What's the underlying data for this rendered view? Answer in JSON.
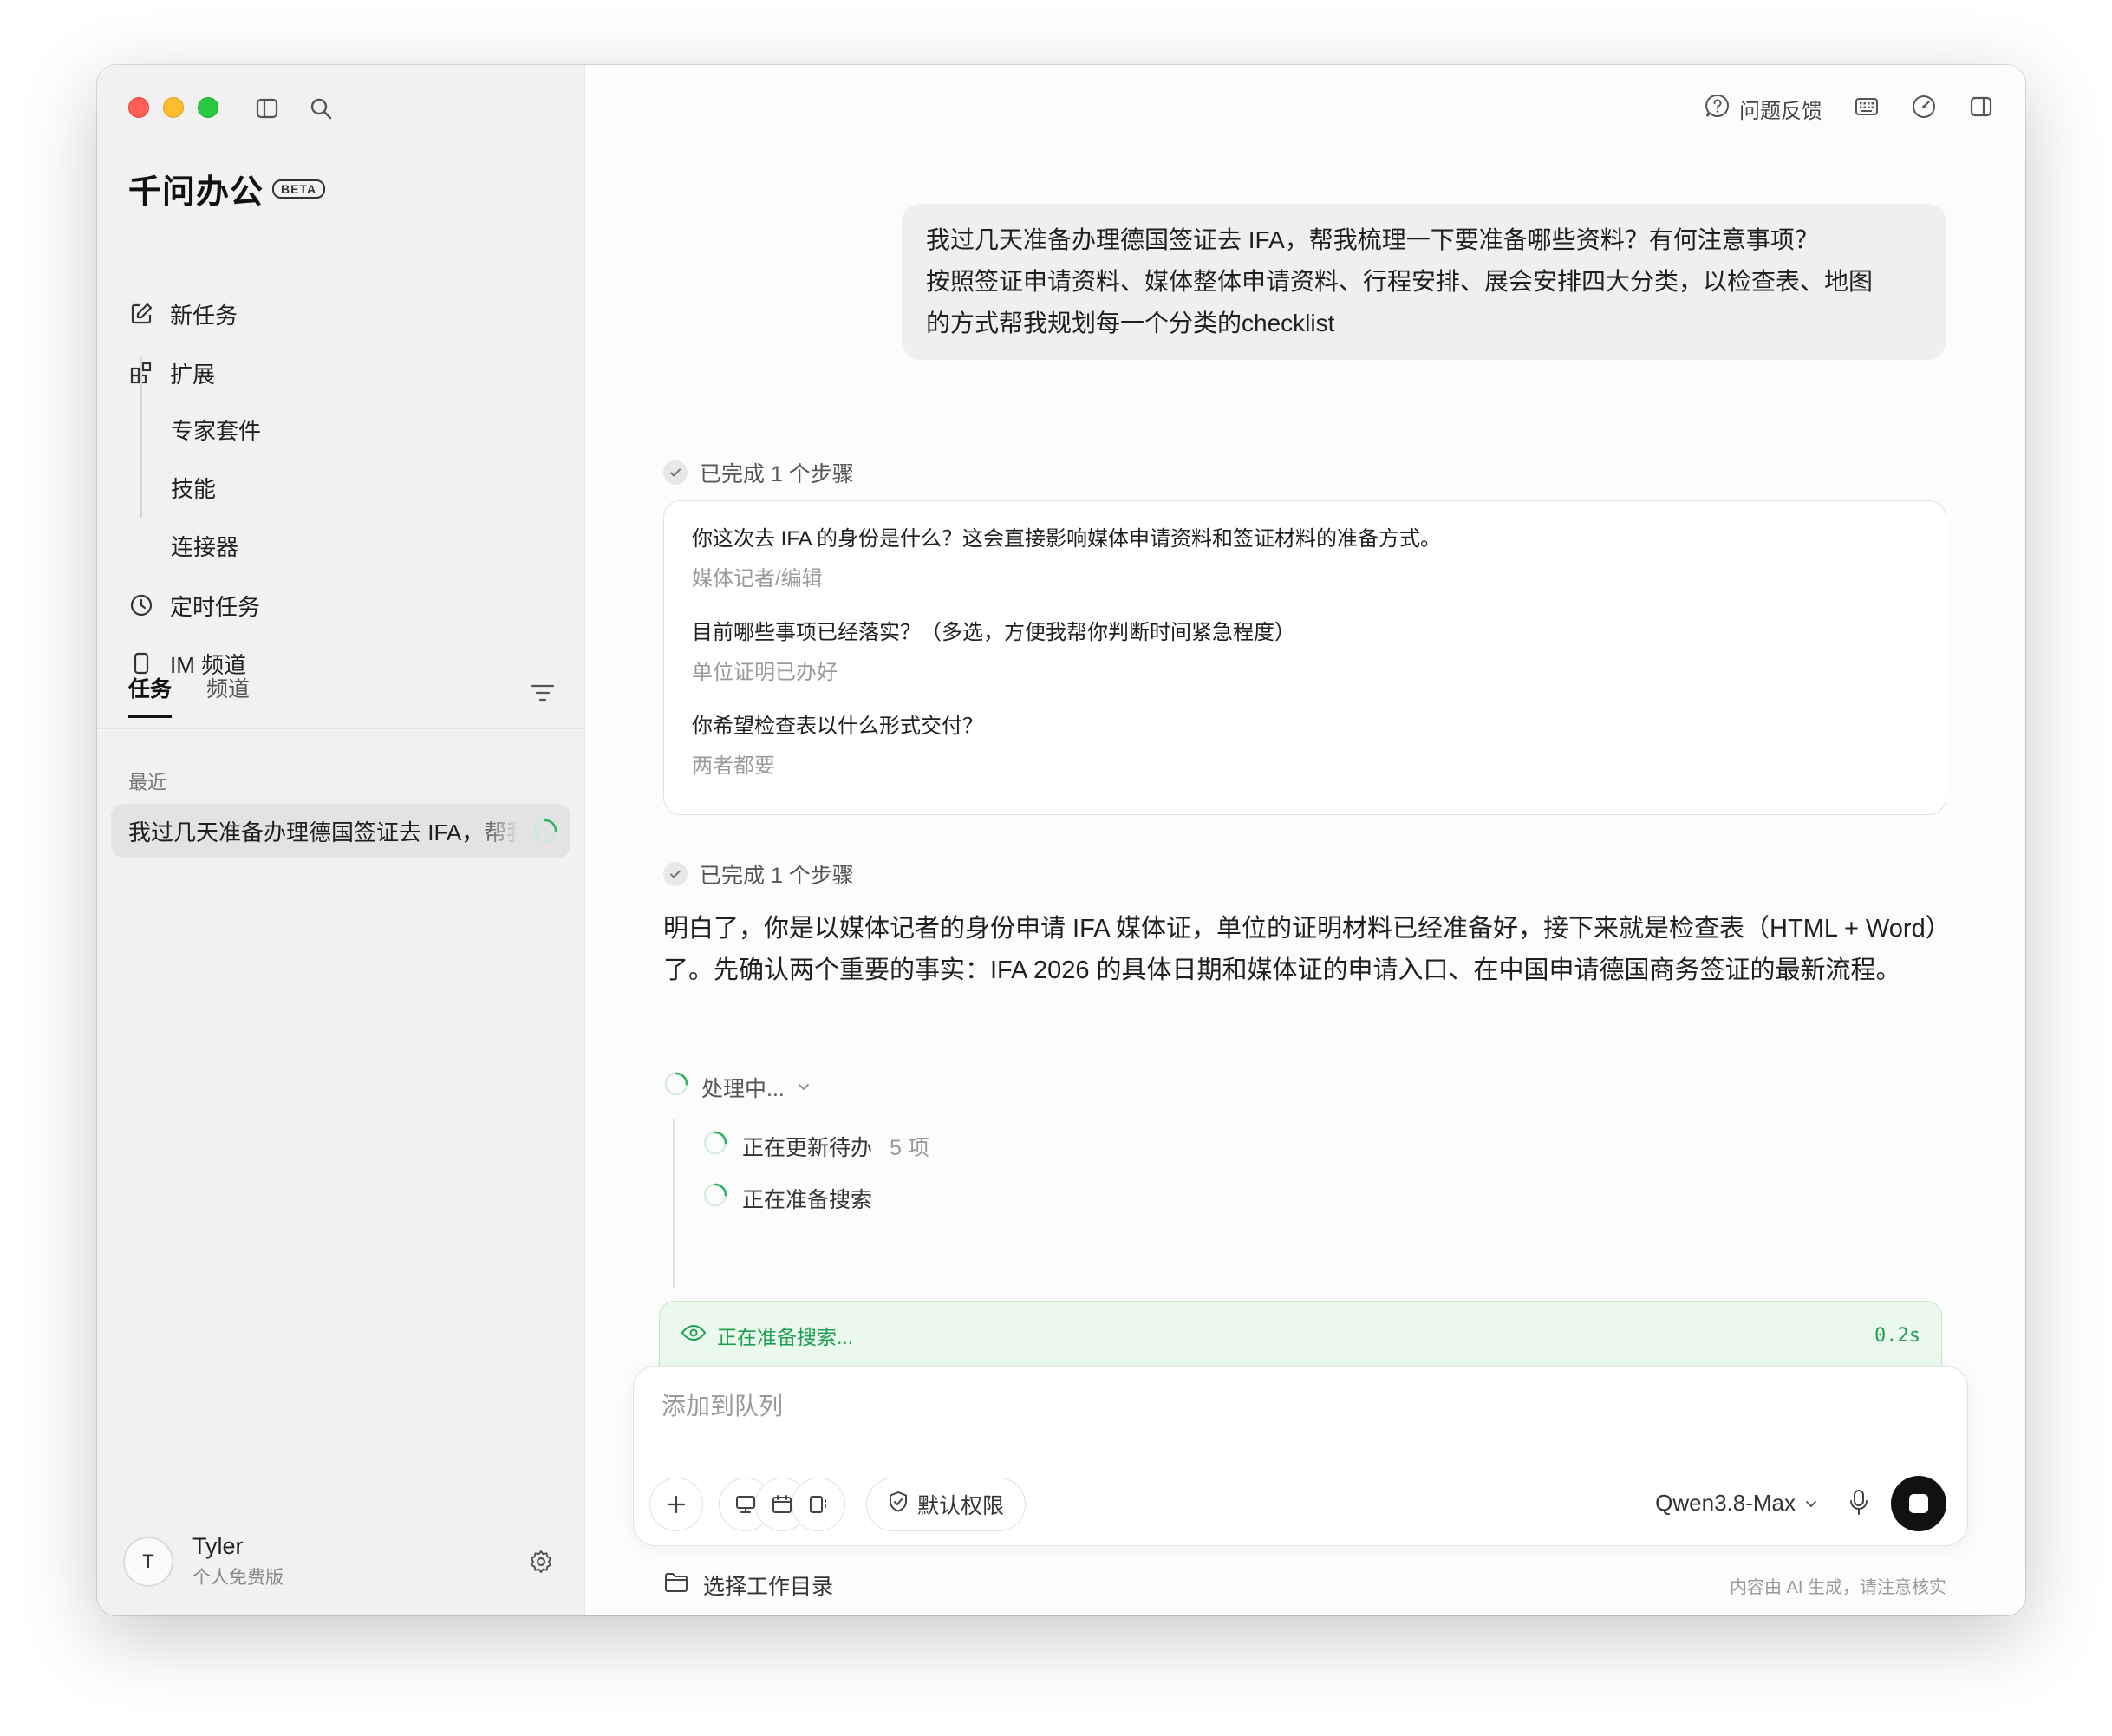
{
  "app": {
    "brand": "千问办公",
    "badge": "BETA"
  },
  "sidebar": {
    "nav": [
      {
        "label": "新任务",
        "icon": "edit-icon"
      },
      {
        "label": "扩展",
        "icon": "grid-plus-icon"
      }
    ],
    "ext_sub": [
      "专家套件",
      "技能",
      "连接器"
    ],
    "nav2": [
      {
        "label": "定时任务",
        "icon": "clock-icon"
      },
      {
        "label": "IM 频道",
        "icon": "phone-icon"
      }
    ],
    "tabs": [
      "任务",
      "频道"
    ],
    "recent_label": "最近",
    "recent_task": "我过几天准备办理德国签证去 IFA，帮我梳理",
    "user": {
      "avatar": "T",
      "name": "Tyler",
      "plan": "个人免费版"
    }
  },
  "header": {
    "feedback": "问题反馈"
  },
  "chat": {
    "user_message": [
      "我过几天准备办理德国签证去 IFA，帮我梳理一下要准备哪些资料？有何注意事项？",
      "按照签证申请资料、媒体整体申请资料、行程安排、展会安排四大分类，以检查表、地图",
      "的方式帮我规划每一个分类的checklist"
    ],
    "step1": "已完成 1 个步骤",
    "qa": [
      {
        "q": "你这次去 IFA 的身份是什么？这会直接影响媒体申请资料和签证材料的准备方式。",
        "a": "媒体记者/编辑"
      },
      {
        "q": "目前哪些事项已经落实？（多选，方便我帮你判断时间紧急程度）",
        "a": "单位证明已办好"
      },
      {
        "q": "你希望检查表以什么形式交付？",
        "a": "两者都要"
      }
    ],
    "step2": "已完成 1 个步骤",
    "reply": "明白了，你是以媒体记者的身份申请 IFA 媒体证，单位的证明材料已经准备好，接下来就是检查表（HTML + Word）了。先确认两个重要的事实：IFA 2026 的具体日期和媒体证的申请入口、在中国申请德国商务签证的最新流程。",
    "processing": "处理中...",
    "sub_tasks": [
      {
        "label": "正在更新待办",
        "count": "5 项"
      },
      {
        "label": "正在准备搜索",
        "count": ""
      }
    ],
    "search_status": "正在准备搜索...",
    "search_time": "0.2s"
  },
  "composer": {
    "placeholder": "添加到队列",
    "permission": "默认权限",
    "model": "Qwen3.8-Max"
  },
  "footer": {
    "workdir": "选择工作目录",
    "disclaimer": "内容由 AI 生成，请注意核实"
  },
  "colors": {
    "accent_green": "#1f9f52",
    "banner_bg": "#eaf8ee"
  }
}
